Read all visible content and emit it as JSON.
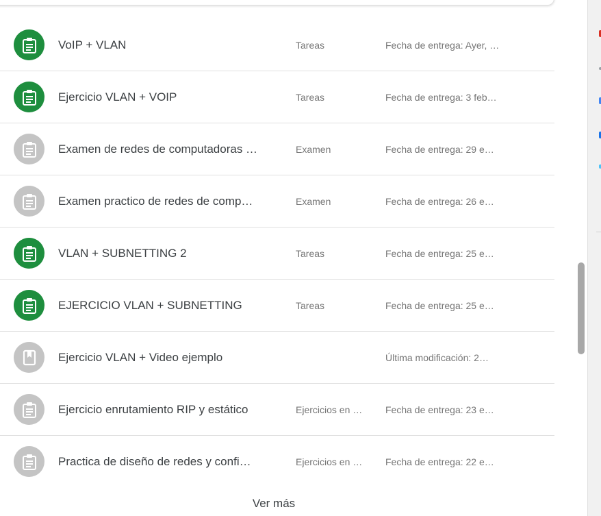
{
  "assignments": [
    {
      "title": "VoIP + VLAN",
      "category": "Tareas",
      "due": "Fecha de entrega: Ayer, …",
      "icon": "assignment-icon",
      "icon_color": "#1e8e3e"
    },
    {
      "title": "Ejercicio VLAN + VOIP",
      "category": "Tareas",
      "due": "Fecha de entrega: 3 feb…",
      "icon": "assignment-icon",
      "icon_color": "#1e8e3e"
    },
    {
      "title": "Examen de redes de computadoras …",
      "category": "Examen",
      "due": "Fecha de entrega: 29 e…",
      "icon": "assignment-icon",
      "icon_color": "#c4c4c4"
    },
    {
      "title": "Examen practico de redes de comp…",
      "category": "Examen",
      "due": "Fecha de entrega: 26 e…",
      "icon": "assignment-icon",
      "icon_color": "#c4c4c4"
    },
    {
      "title": "VLAN + SUBNETTING 2",
      "category": "Tareas",
      "due": "Fecha de entrega: 25 e…",
      "icon": "assignment-icon",
      "icon_color": "#1e8e3e"
    },
    {
      "title": "EJERCICIO VLAN + SUBNETTING",
      "category": "Tareas",
      "due": "Fecha de entrega: 25 e…",
      "icon": "assignment-icon",
      "icon_color": "#1e8e3e"
    },
    {
      "title": "Ejercicio VLAN + Video ejemplo",
      "category": "",
      "due": "Última modificación: 2…",
      "icon": "material-book-icon",
      "icon_color": "#c4c4c4"
    },
    {
      "title": "Ejercicio enrutamiento RIP y estático",
      "category": "Ejercicios en …",
      "due": "Fecha de entrega: 23 e…",
      "icon": "assignment-icon",
      "icon_color": "#c4c4c4"
    },
    {
      "title": "Practica de diseño de redes y confi…",
      "category": "Ejercicios en …",
      "due": "Fecha de entrega: 22 e…",
      "icon": "assignment-icon",
      "icon_color": "#c4c4c4"
    }
  ],
  "see_more_label": "Ver más",
  "colors": {
    "accent_green": "#1e8e3e",
    "inactive_grey": "#c4c4c4",
    "text": "#3c4043",
    "muted": "#757575"
  }
}
